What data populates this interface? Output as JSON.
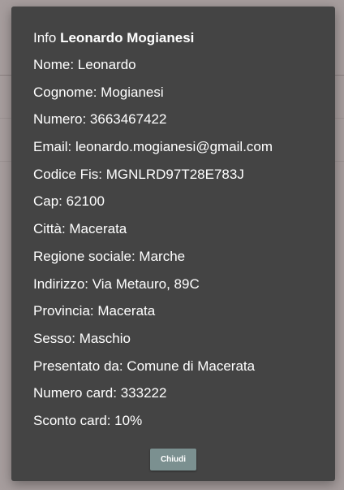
{
  "modal": {
    "title_prefix": "Info ",
    "title_name": "Leonardo Mogianesi",
    "fields": [
      "Nome: Leonardo",
      "Cognome: Mogianesi",
      "Numero: 3663467422",
      "Email: leonardo.mogianesi@gmail.com",
      "Codice Fis: MGNLRD97T28E783J",
      "Cap: 62100",
      "Città: Macerata",
      "Regione sociale: Marche",
      "Indirizzo: Via Metauro, 89C",
      "Provincia: Macerata",
      "Sesso: Maschio",
      "Presentato da: Comune di Macerata",
      "Numero card: 333222",
      "Sconto card: 10%"
    ],
    "close_label": "Chiudi"
  },
  "colors": {
    "overlay_background": "#a69d9d",
    "modal_background": "#444444",
    "button_background": "#7b9090",
    "text": "#ffffff"
  }
}
